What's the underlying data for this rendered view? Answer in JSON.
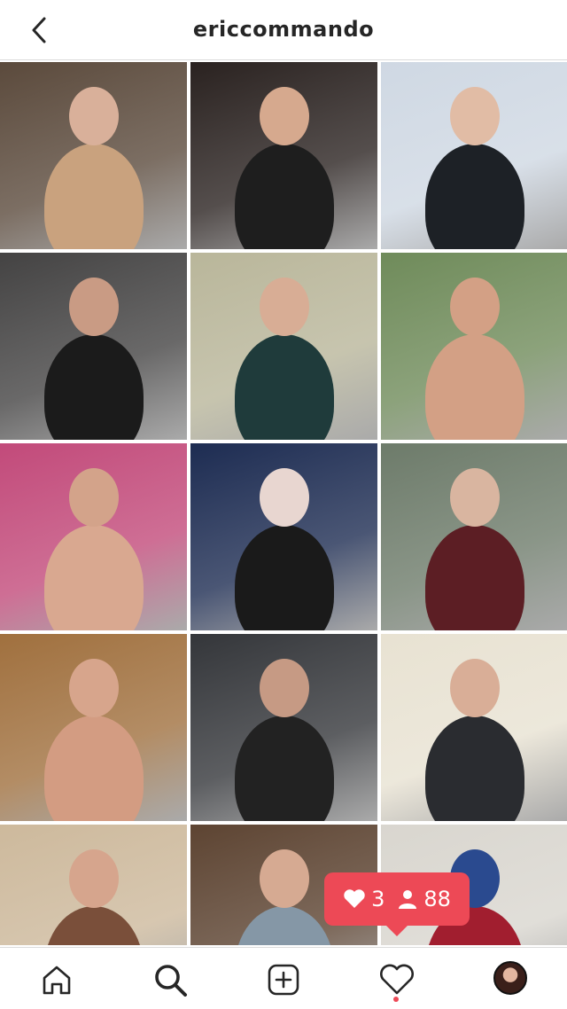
{
  "header": {
    "username": "ericcommando"
  },
  "notification": {
    "likes": "3",
    "followers": "88"
  },
  "tabs": [
    "home",
    "search",
    "new-post",
    "activity",
    "profile"
  ],
  "colors": {
    "accent": "#ed4956",
    "text": "#262626",
    "divider": "#dbdbdb"
  },
  "grid": [
    {
      "bg": "#5b4a3c",
      "fig": "#c9a27e",
      "head": "#d9b09a"
    },
    {
      "bg": "#2a2220",
      "fig": "#1e1e1e",
      "head": "#d6a98e"
    },
    {
      "bg": "#cfd8e3",
      "fig": "#1d2126",
      "head": "#e1bca5"
    },
    {
      "bg": "#444343",
      "fig": "#1b1b1b",
      "head": "#c99b84"
    },
    {
      "bg": "#b9b69a",
      "fig": "#1f3b3b",
      "head": "#d8ad95"
    },
    {
      "bg": "#6f8b5a",
      "fig": "#d3a085",
      "head": "#d3a085"
    },
    {
      "bg": "#c24a7a",
      "fig": "#d9a890",
      "head": "#d3a38a"
    },
    {
      "bg": "#1d2c52",
      "fig": "#1a1a1a",
      "head": "#e8d6d0"
    },
    {
      "bg": "#6d7b6a",
      "fig": "#5c1e24",
      "head": "#d9b5a0"
    },
    {
      "bg": "#a0703e",
      "fig": "#d39c82",
      "head": "#d7a58c"
    },
    {
      "bg": "#34363a",
      "fig": "#222222",
      "head": "#c69a84"
    },
    {
      "bg": "#e8e2d2",
      "fig": "#2a2c30",
      "head": "#d9ae97"
    },
    {
      "bg": "#cdb99c",
      "fig": "#7a4f3a",
      "head": "#d6a58d"
    },
    {
      "bg": "#5d4432",
      "fig": "#8597a6",
      "head": "#d6aa92"
    },
    {
      "bg": "#d9d6cf",
      "fig": "#a11e2f",
      "head": "#2a4a8f"
    }
  ]
}
